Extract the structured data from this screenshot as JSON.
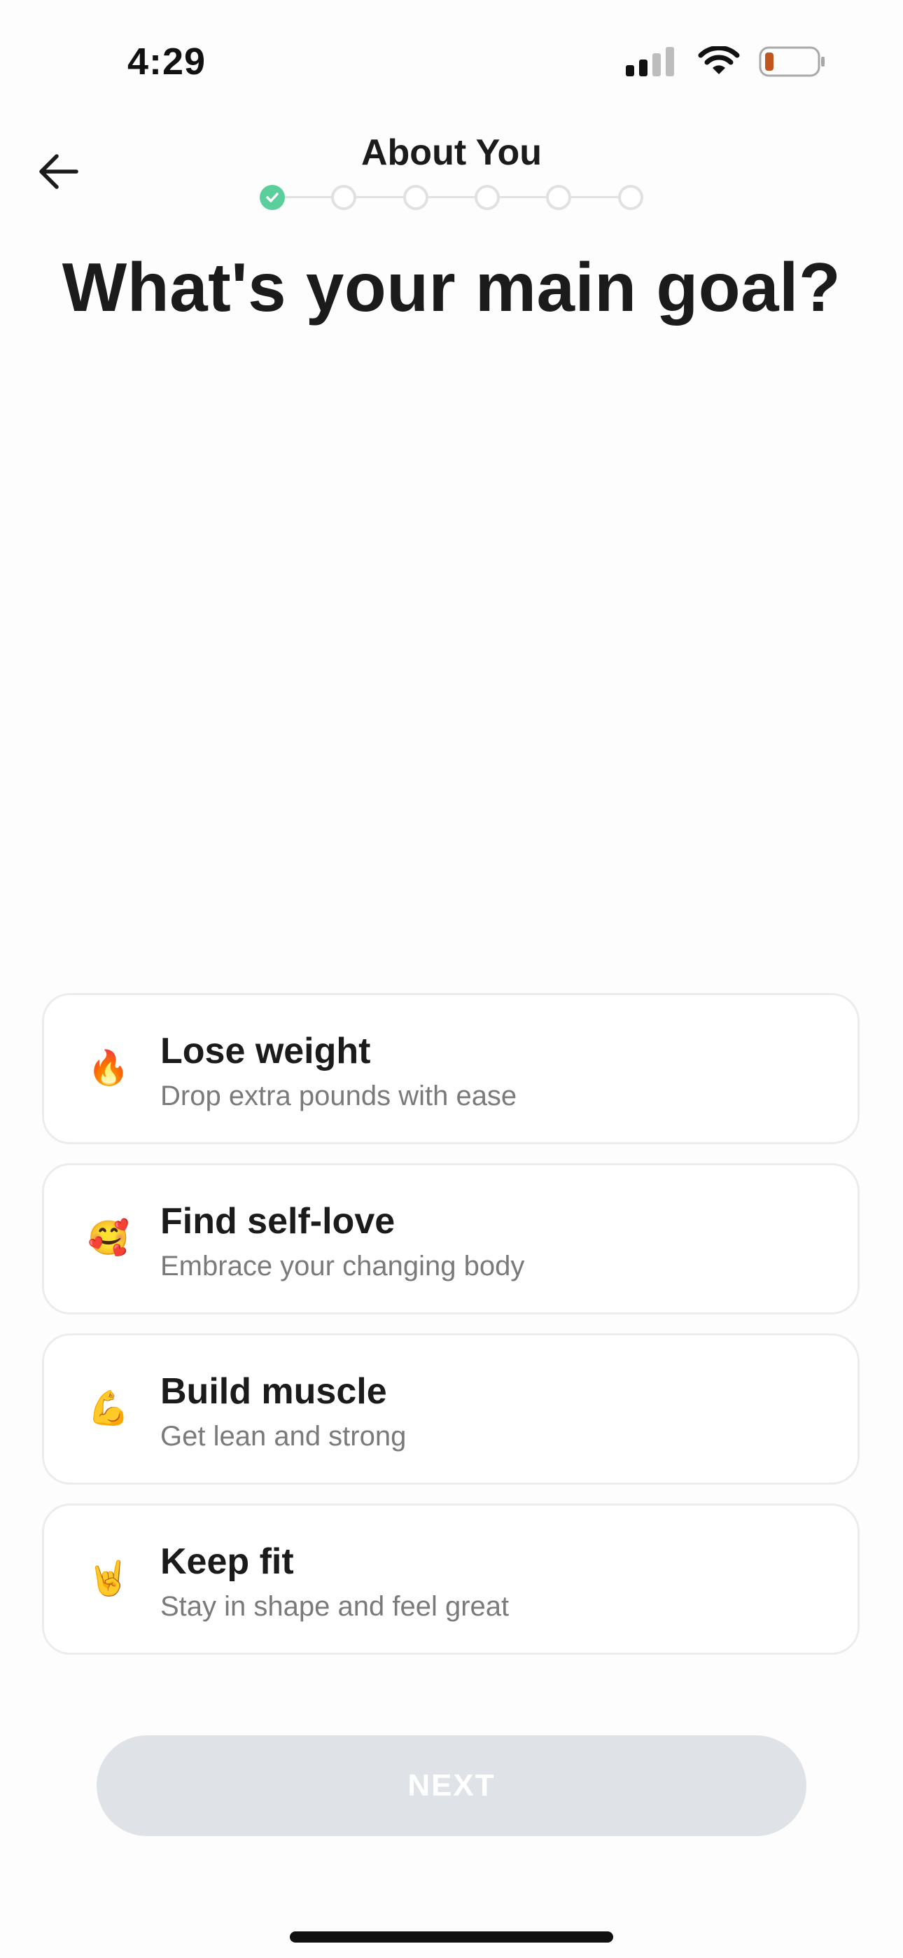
{
  "status_bar": {
    "time": "4:29",
    "icons": [
      "cellular-signal-icon",
      "wifi-icon",
      "battery-low-icon"
    ],
    "battery_color": "#c0551e"
  },
  "header": {
    "title": "About You",
    "back_icon": "arrow-left-icon"
  },
  "stepper": {
    "total_steps": 6,
    "completed_steps": 1,
    "done_color": "#5bcf9b",
    "pending_color": "#e1e1e1"
  },
  "question": "What's your main goal?",
  "options": [
    {
      "emoji": "🔥",
      "icon": "fire-emoji-icon",
      "title": "Lose weight",
      "subtitle": "Drop extra pounds with ease"
    },
    {
      "emoji": "🥰",
      "icon": "smiling-face-hearts-emoji-icon",
      "title": "Find self-love",
      "subtitle": "Embrace your changing body"
    },
    {
      "emoji": "💪",
      "icon": "flexed-biceps-emoji-icon",
      "title": "Build muscle",
      "subtitle": "Get lean and strong"
    },
    {
      "emoji": "🤘",
      "icon": "rock-on-hand-emoji-icon",
      "title": "Keep fit",
      "subtitle": "Stay in shape and feel great"
    }
  ],
  "next_button": {
    "label": "NEXT",
    "enabled": false,
    "color": "#dfe2e6"
  }
}
